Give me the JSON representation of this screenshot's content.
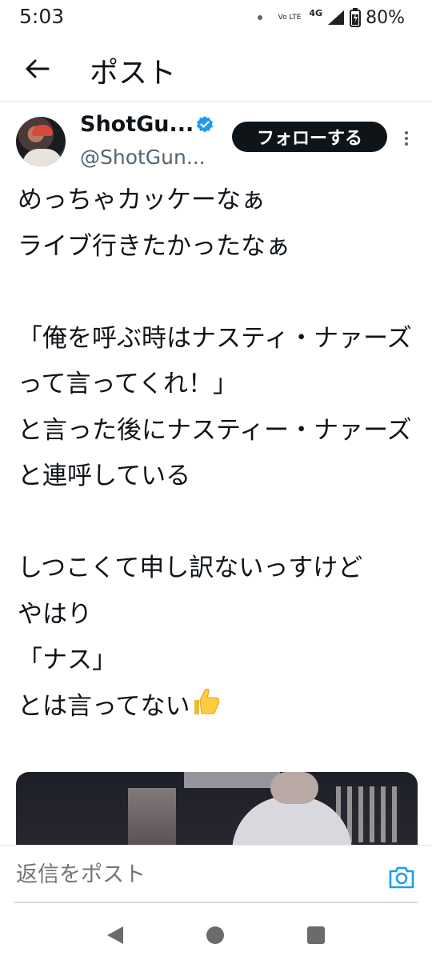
{
  "status_bar": {
    "time": "5:03",
    "volte": "Vo LTE",
    "network": "4G",
    "battery": "80%"
  },
  "app_bar": {
    "title": "ポスト"
  },
  "author": {
    "display_name": "ShotGu...",
    "handle": "@ShotGun...",
    "follow_label": "フォローする",
    "verified": true
  },
  "tweet": {
    "text": "めっちゃカッケーなぁ\nライブ行きたかったなぁ\n\n「俺を呼ぶ時はナスティ・ナァーズって言ってくれ！」\nと言った後にナスティー・ナァーズと連呼している\n\nしつこくて申し訳ないっすけど\nやはり\n「ナス」\nとは言ってない",
    "emoji": "thumbs-up"
  },
  "reply": {
    "placeholder": "返信をポスト"
  },
  "colors": {
    "text": "#0f1419",
    "secondary": "#536471",
    "accent": "#1d9bf0",
    "follow_bg": "#0f1419"
  }
}
